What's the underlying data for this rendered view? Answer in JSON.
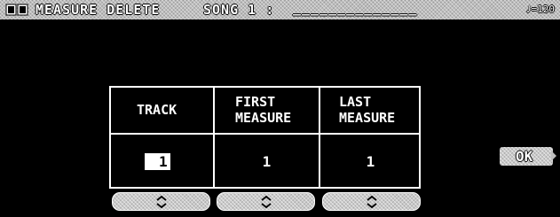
{
  "titlebar": {
    "icon": "screen-icon",
    "title": "MEASURE DELETE",
    "song_label": "SONG 1 :",
    "song_name": "______________",
    "tempo_icon": "quarter-note-icon",
    "tempo_value": "=120"
  },
  "table": {
    "headers": {
      "track": "TRACK",
      "first_measure": "FIRST\nMEASURE",
      "last_measure": "LAST\nMEASURE"
    },
    "values": {
      "track": "1",
      "first_measure": "1",
      "last_measure": "1"
    }
  },
  "steppers": {
    "icon": "up-down-arrows-icon"
  },
  "ok_button": {
    "label": "OK",
    "arrow_icon": "right-arrow-icon"
  }
}
